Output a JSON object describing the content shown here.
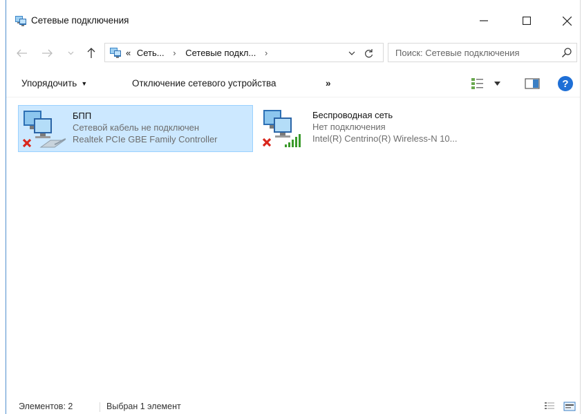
{
  "window": {
    "title": "Сетевые подключения",
    "icon": "network-connections-icon"
  },
  "address": {
    "overflow": "«",
    "crumbs": [
      "Сеть...",
      "Сетевые подкл..."
    ],
    "separator": "›"
  },
  "search": {
    "placeholder": "Поиск: Сетевые подключения"
  },
  "toolbar": {
    "organize_label": "Упорядочить",
    "organize_caret": "▼",
    "disable_label": "Отключение сетевого устройства",
    "more_label": "»",
    "help_label": "?"
  },
  "items": [
    {
      "name": "БПП",
      "status": "Сетевой кабель не подключен",
      "device": "Realtek PCIe GBE Family Controller",
      "selected": true,
      "icon": "ethernet-disconnected-icon"
    },
    {
      "name": "Беспроводная сеть",
      "status": "Нет подключения",
      "device": "Intel(R) Centrino(R) Wireless-N 10...",
      "selected": false,
      "icon": "wireless-disconnected-icon"
    }
  ],
  "statusbar": {
    "count": "Элементов: 2",
    "selected": "Выбран 1 элемент"
  },
  "colors": {
    "selection_bg": "#cce8ff",
    "selection_border": "#99d1ff",
    "help_blue": "#1e6fd6",
    "error_red": "#d9261c",
    "signal_green": "#3a9a2a"
  }
}
